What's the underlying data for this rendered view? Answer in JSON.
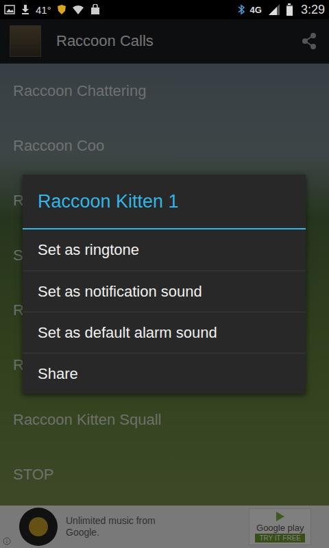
{
  "status_bar": {
    "temperature": "41°",
    "network": "4G",
    "time": "3:29",
    "signal_level": 0.75,
    "battery_level": 0.9
  },
  "action_bar": {
    "title": "Raccoon Calls"
  },
  "list": {
    "items": [
      "Raccoon Chattering",
      "Raccoon Coo",
      "R",
      "S",
      "R",
      "R",
      "Raccoon Kitten Squall",
      "STOP"
    ]
  },
  "dialog": {
    "title": "Raccoon Kitten 1",
    "options": [
      "Set as ringtone",
      "Set as notification sound",
      "Set as default alarm sound",
      "Share"
    ]
  },
  "ad": {
    "text": "Unlimited music from Google.",
    "store": "Google play",
    "cta": "TRY IT FREE"
  }
}
